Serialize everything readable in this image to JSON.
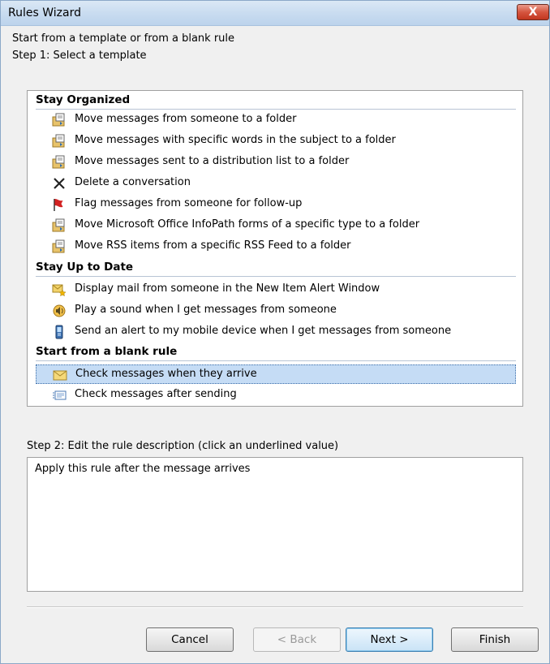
{
  "window": {
    "title": "Rules Wizard",
    "close_label": "X"
  },
  "intro_label": "Start from a template or from a blank rule",
  "step1_label": "Step 1: Select a template",
  "templates": {
    "stay_organized": {
      "heading": "Stay Organized",
      "items": [
        {
          "label": "Move messages from someone to a folder",
          "icon": "move-to-folder-icon"
        },
        {
          "label": "Move messages with specific words in the subject to a folder",
          "icon": "move-to-folder-icon"
        },
        {
          "label": "Move messages sent to a distribution list to a folder",
          "icon": "move-to-folder-icon"
        },
        {
          "label": "Delete a conversation",
          "icon": "delete-x-icon"
        },
        {
          "label": "Flag messages from someone for follow-up",
          "icon": "red-flag-icon"
        },
        {
          "label": "Move Microsoft Office InfoPath forms of a specific type to a folder",
          "icon": "move-to-folder-icon"
        },
        {
          "label": "Move RSS items from a specific RSS Feed to a folder",
          "icon": "move-to-folder-icon"
        }
      ]
    },
    "stay_up_to_date": {
      "heading": "Stay Up to Date",
      "items": [
        {
          "label": "Display mail from someone in the New Item Alert Window",
          "icon": "alert-star-icon"
        },
        {
          "label": "Play a sound when I get messages from someone",
          "icon": "speaker-icon"
        },
        {
          "label": "Send an alert to my mobile device when I get messages from someone",
          "icon": "mobile-phone-icon"
        }
      ]
    },
    "blank_rule": {
      "heading": "Start from a blank rule",
      "items": [
        {
          "label": "Check messages when they arrive",
          "icon": "envelope-icon",
          "selected": true
        },
        {
          "label": "Check messages after sending",
          "icon": "sent-message-icon"
        }
      ]
    }
  },
  "step2_label": "Step 2: Edit the rule description (click an underlined value)",
  "rule_description": "Apply this rule after the message arrives",
  "buttons": {
    "cancel": "Cancel",
    "back": "< Back",
    "next": "Next >",
    "finish": "Finish"
  },
  "colors": {
    "selection": "#c5dcf5",
    "title_gradient_top": "#dbe8f5",
    "close_red": "#c2361f"
  }
}
